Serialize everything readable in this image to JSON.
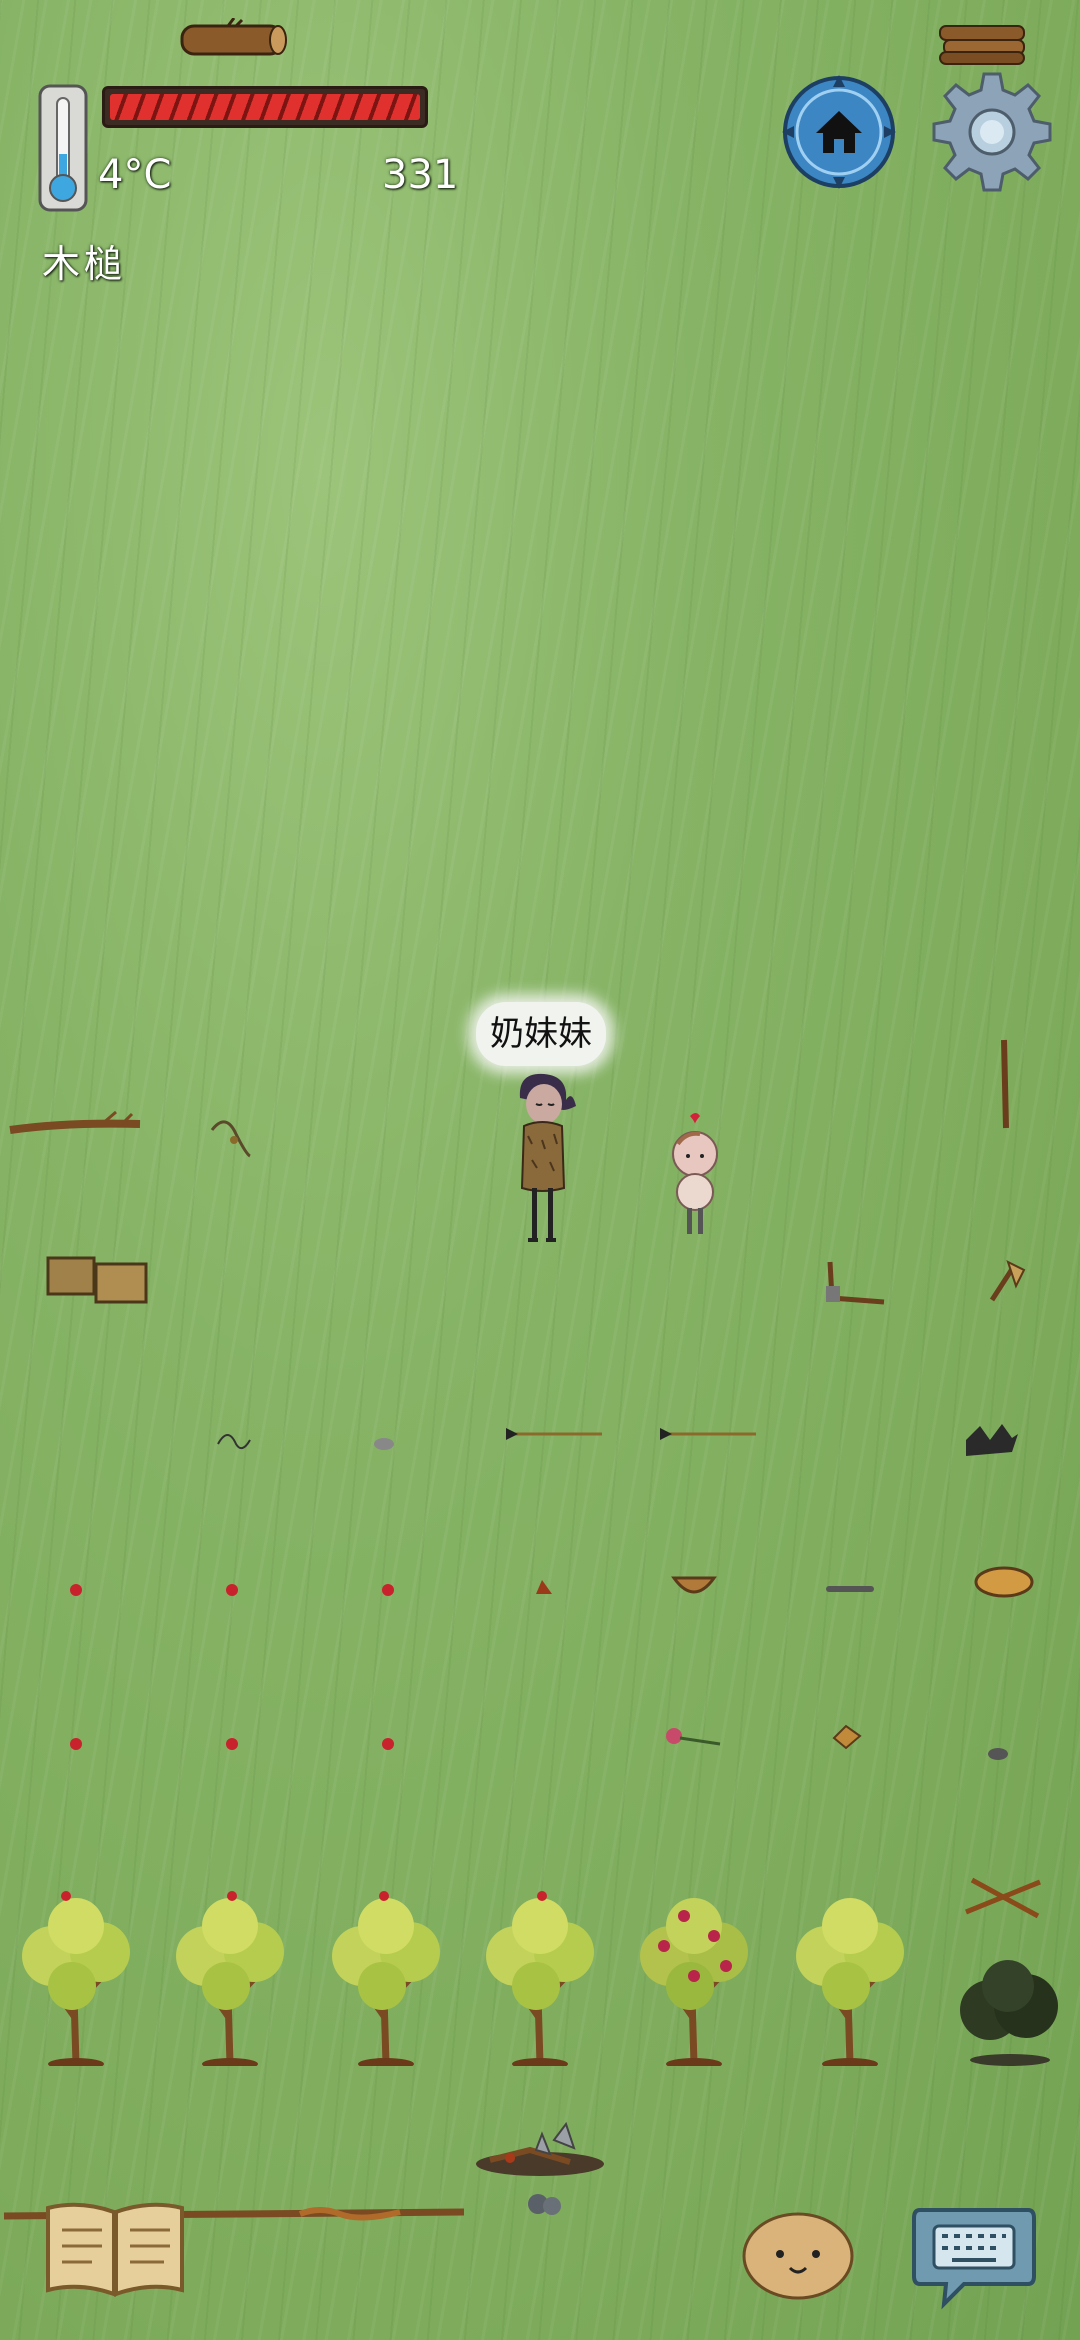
{
  "hud": {
    "temperature": "4°C",
    "score": "331",
    "held_item": "木槌",
    "health_fraction": 1.0
  },
  "character": {
    "name_label": "奶妹妹"
  },
  "colors": {
    "grass": "#86b365",
    "health_red": "#e0312f",
    "home_blue": "#3d86c4",
    "settings_gray": "#8da4b8"
  },
  "icons": [
    "thermometer-icon",
    "home-icon",
    "gear-icon",
    "book-icon",
    "emote-icon",
    "keyboard-icon"
  ]
}
